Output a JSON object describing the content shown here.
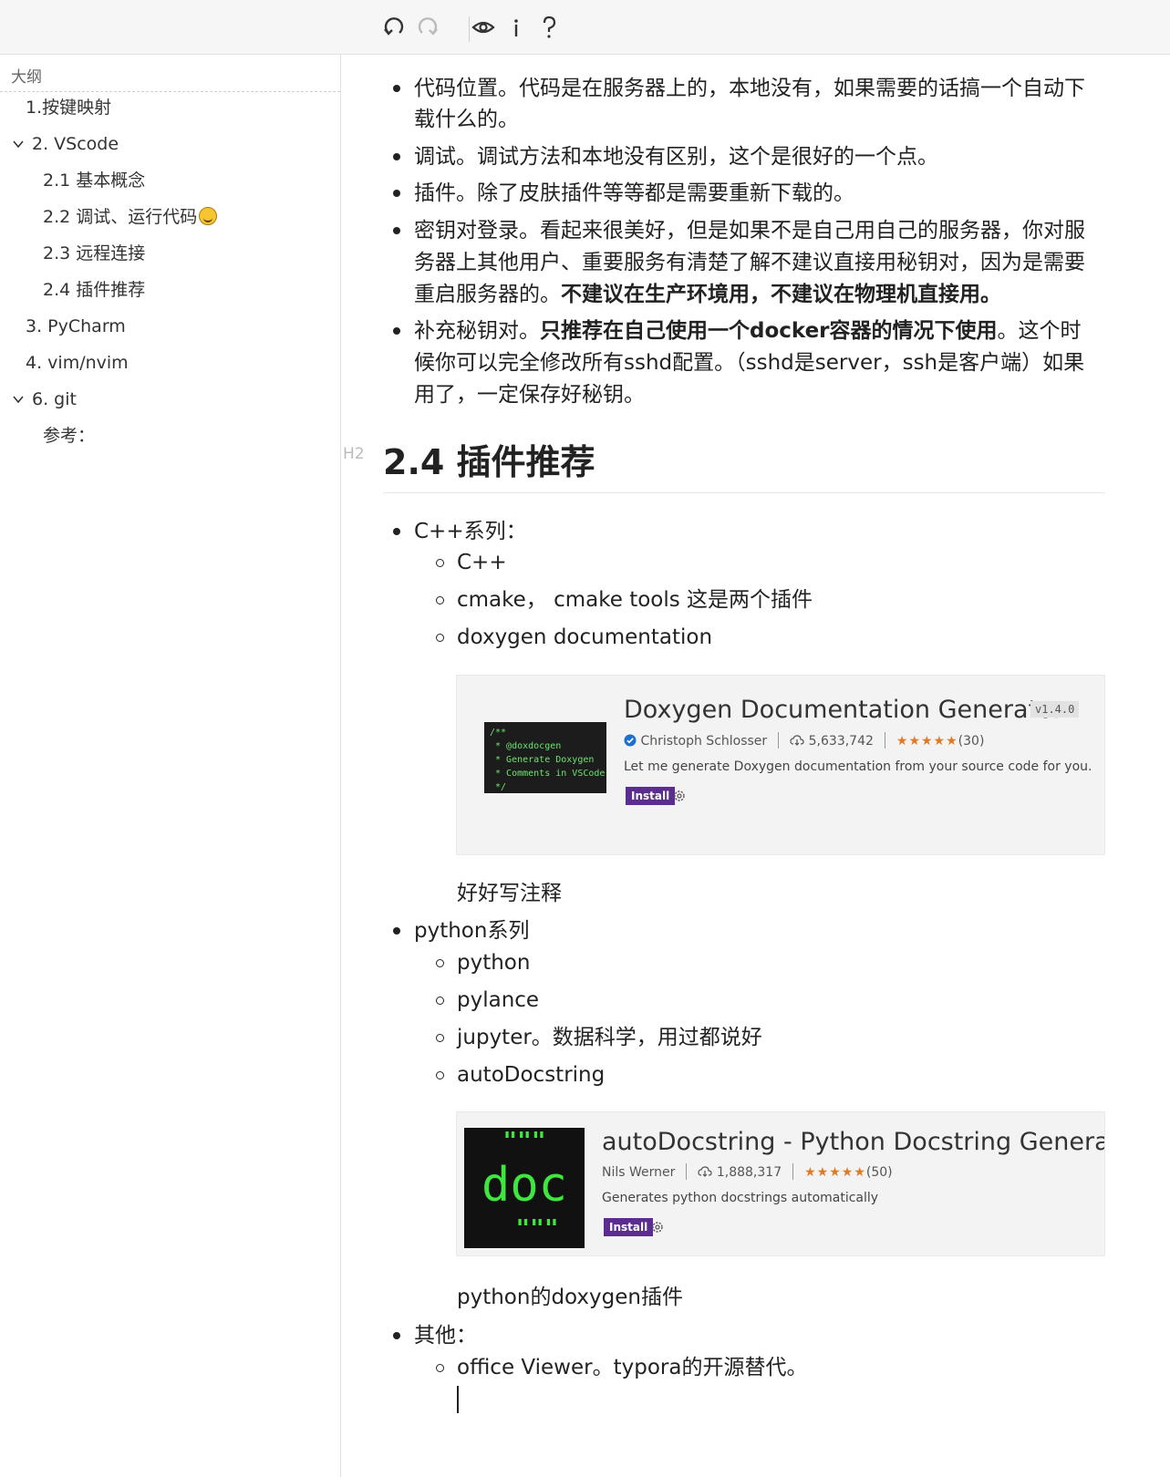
{
  "toolbar": {
    "icons": [
      "undo-icon",
      "redo-icon",
      "eye-icon",
      "info-icon",
      "help-icon"
    ]
  },
  "outline": {
    "title": "大纲",
    "items": [
      {
        "label": "1.按键映射"
      },
      {
        "label": "2. VScode"
      },
      {
        "label": "2.1 基本概念"
      },
      {
        "label": "2.2 调试、运行代码"
      },
      {
        "label": "2.3 远程连接"
      },
      {
        "label": "2.4 插件推荐"
      },
      {
        "label": "3. PyCharm"
      },
      {
        "label": "4. vim/nvim"
      },
      {
        "label": "6. git"
      },
      {
        "label": "参考："
      }
    ]
  },
  "content": {
    "top_list": {
      "item1_line1": "代码位置。代码是在服务器上的，本地没有，如果需要的话搞一个自动下",
      "item1_line2": "载什么的。",
      "item2": "调试。调试方法和本地没有区别，这个是很好的一个点。",
      "item3": "插件。除了皮肤插件等等都是需要重新下载的。",
      "item4_line1": "密钥对登录。看起来很美好，但是如果不是自己用自己的服务器，你对服",
      "item4_line2": "务器上其他用户、重要服务有清楚了解不建议直接用秘钥对，因为是需要",
      "item4_line3_plain": "重启服务器的。",
      "item4_line3_bold": "不建议在生产环境用，不建议在物理机直接用。",
      "item5_line1_plain1": "补充秘钥对。",
      "item5_line1_bold": "只推荐在自己使用一个docker容器的情况下使用",
      "item5_line1_plain2": "。这个时",
      "item5_line2": "候你可以完全修改所有sshd配置。（sshd是server，ssh是客户端）如果",
      "item5_line3": "用了，一定保存好秘钥。"
    },
    "heading": {
      "tag": "H2",
      "text": "2.4 插件推荐"
    },
    "cpp": {
      "label": "C++系列：",
      "sub": [
        "C++",
        "cmake，  cmake tools 这是两个插件",
        "doxygen documentation"
      ],
      "note": "好好写注释"
    },
    "doxygen_card": {
      "title": "Doxygen Documentation Generator",
      "version": "v1.4.0",
      "author": "Christoph Schlosser",
      "installs": "5,633,742",
      "stars": "★★★★★",
      "rating_count": "(30)",
      "description": "Let me generate Doxygen documentation from your source code for you.",
      "install_label": "Install",
      "code_lines": "/**\n * @doxdocgen\n * Generate Doxygen\n * Comments in VSCode\n */"
    },
    "python": {
      "label": "python系列",
      "sub": [
        "python",
        "pylance",
        "jupyter。数据科学，用过都说好",
        "autoDocstring"
      ],
      "note": "python的doxygen插件"
    },
    "autodoc_card": {
      "title": "autoDocstring - Python Docstring Generat",
      "author": "Nils Werner",
      "installs": "1,888,317",
      "stars": "★★★★★",
      "rating_count": "(50)",
      "description": "Generates python docstrings automatically",
      "install_label": "Install",
      "logo_top": "\"\"\"",
      "logo_mid": "doc",
      "logo_bottom": "\"\"\""
    },
    "other": {
      "label": "其他：",
      "sub": [
        "office Viewer。typora的开源替代。"
      ]
    }
  }
}
